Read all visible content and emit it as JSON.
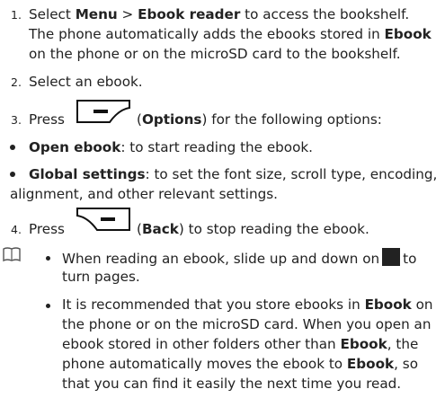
{
  "step1": {
    "num": "1.",
    "l1_a": "Select ",
    "l1_menu": "Menu",
    "l1_gt": " > ",
    "l1_reader": "Ebook reader",
    "l1_b": " to access the bookshelf.",
    "l2_a": "The phone automatically adds the ebooks stored in ",
    "l2_ebook": "Ebook",
    "l3": "on the phone or on the microSD card to the bookshelf."
  },
  "step2": {
    "num": "2.",
    "text": "Select an ebook."
  },
  "step3": {
    "num": "3.",
    "press": "Press",
    "paren_open": "(",
    "options": "Options",
    "rest": ") for the following options:"
  },
  "bullets": [
    {
      "bold": "Open ebook",
      "rest": ": to start reading the ebook."
    },
    {
      "bold": "Global settings",
      "rest": ": to set the font size, scroll type, encoding,",
      "rest2": "alignment, and other relevant settings."
    }
  ],
  "step4": {
    "num": "4.",
    "press": "Press",
    "paren_open": "(",
    "back": "Back",
    "rest": ") to stop reading the ebook."
  },
  "notes": {
    "n1_a": "When reading an ebook, slide up and down on",
    "n1_b": "to",
    "n1_c": "turn pages.",
    "n2_l1_a": "It is recommended that you store ebooks in ",
    "n2_l1_ebook": "Ebook",
    "n2_l1_b": " on",
    "n2_l2": "the phone or on the microSD card. When you open an",
    "n2_l3_a": "ebook stored in other folders other than ",
    "n2_l3_ebook": "Ebook",
    "n2_l3_b": ", the",
    "n2_l4_a": "phone automatically moves the ebook to ",
    "n2_l4_ebook": "Ebook",
    "n2_l4_b": ", so",
    "n2_l5": "that you can find it easily the next time you read."
  }
}
